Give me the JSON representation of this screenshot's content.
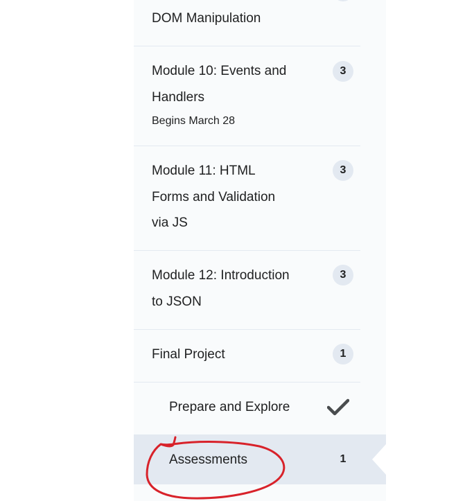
{
  "nav": {
    "items": [
      {
        "title": "DOM Manipulation"
      },
      {
        "title": "Module 10: Events and Handlers",
        "subtitle": "Begins March 28",
        "count": "3"
      },
      {
        "title": "Module 11: HTML Forms and Validation via JS",
        "count": "3"
      },
      {
        "title": "Module 12: Introduction to JSON",
        "count": "3"
      },
      {
        "title": "Final Project",
        "count": "1"
      }
    ],
    "subitems": [
      {
        "title": "Prepare and Explore",
        "status_icon": "checkmark-icon"
      },
      {
        "title": "Assessments",
        "count": "1",
        "selected": true
      }
    ]
  },
  "annotation": {
    "shape": "freehand-circle",
    "color": "#d8222a"
  },
  "colors": {
    "panel_bg": "#f9fbfc",
    "selected_bg": "#e3e9f1",
    "badge_bg": "#e3e9f1",
    "divider": "#e3e9f1"
  }
}
